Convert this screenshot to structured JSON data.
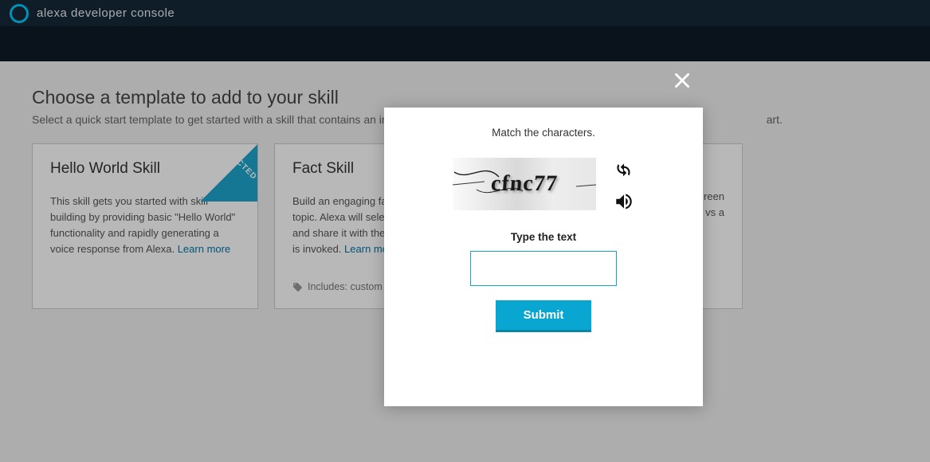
{
  "header": {
    "title": "alexa developer console"
  },
  "page": {
    "title": "Choose a template to add to your skill",
    "subtitle_left": "Select a quick start template to get started with a skill that contains an in",
    "subtitle_right": "art."
  },
  "cards": {
    "hello": {
      "title": "Hello World Skill",
      "desc": "This skill gets you started with skill building by providing basic \"Hello World\" functionality and rapidly generating a voice response from Alexa. ",
      "learn_more": "Learn more",
      "selected": "SELECTED"
    },
    "fact": {
      "title": "Fact Skill",
      "desc_prefix": "Build an engaging fa",
      "desc_line2": "topic. Alexa will sele",
      "desc_line3": "and share it with the",
      "desc_line4": "is invoked. ",
      "learn_more": "Learn mo",
      "tag": "Includes: custom"
    },
    "third": {
      "line1": "reen",
      "line2": "vs a"
    }
  },
  "modal": {
    "heading": "Match the characters.",
    "captcha_text": "cfnc77",
    "type_label": "Type the text",
    "submit": "Submit"
  },
  "icons": {
    "close": "close-icon",
    "refresh": "refresh-icon",
    "audio": "speaker-icon",
    "tag": "tag-icon"
  }
}
